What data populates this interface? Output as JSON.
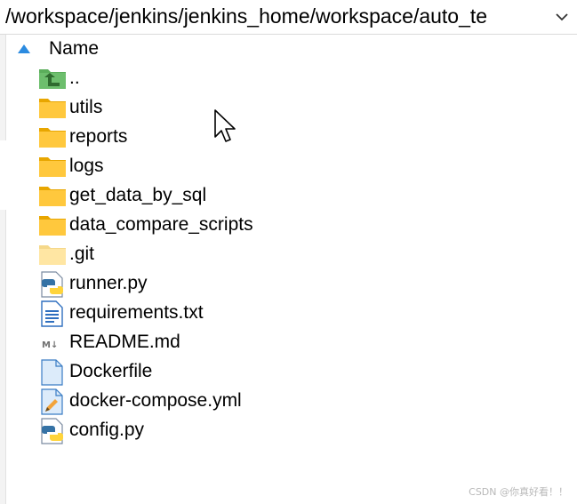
{
  "path_bar": {
    "path": "/workspace/jenkins/jenkins_home/workspace/auto_te"
  },
  "column_header": {
    "label": "Name",
    "sort": "ascending"
  },
  "files": [
    {
      "name": "..",
      "icon": "parent-folder-icon"
    },
    {
      "name": "utils",
      "icon": "folder-icon"
    },
    {
      "name": "reports",
      "icon": "folder-icon"
    },
    {
      "name": "logs",
      "icon": "folder-icon"
    },
    {
      "name": "get_data_by_sql",
      "icon": "folder-icon"
    },
    {
      "name": "data_compare_scripts",
      "icon": "folder-icon"
    },
    {
      "name": ".git",
      "icon": "hidden-folder-icon"
    },
    {
      "name": "runner.py",
      "icon": "python-file-icon"
    },
    {
      "name": "requirements.txt",
      "icon": "text-file-icon"
    },
    {
      "name": "README.md",
      "icon": "markdown-file-icon"
    },
    {
      "name": "Dockerfile",
      "icon": "blank-file-icon"
    },
    {
      "name": "docker-compose.yml",
      "icon": "yaml-file-icon"
    },
    {
      "name": "config.py",
      "icon": "python-file-icon"
    }
  ],
  "watermark": "CSDN @你真好看！！",
  "colors": {
    "folder": "#FFC83D",
    "folder_dark": "#E8A600",
    "hidden_folder": "#FFE6A3",
    "parent_folder": "#5BAE5B",
    "python_blue": "#3572A5",
    "python_yellow": "#FFD43B",
    "sort_arrow": "#2B8BE0"
  }
}
